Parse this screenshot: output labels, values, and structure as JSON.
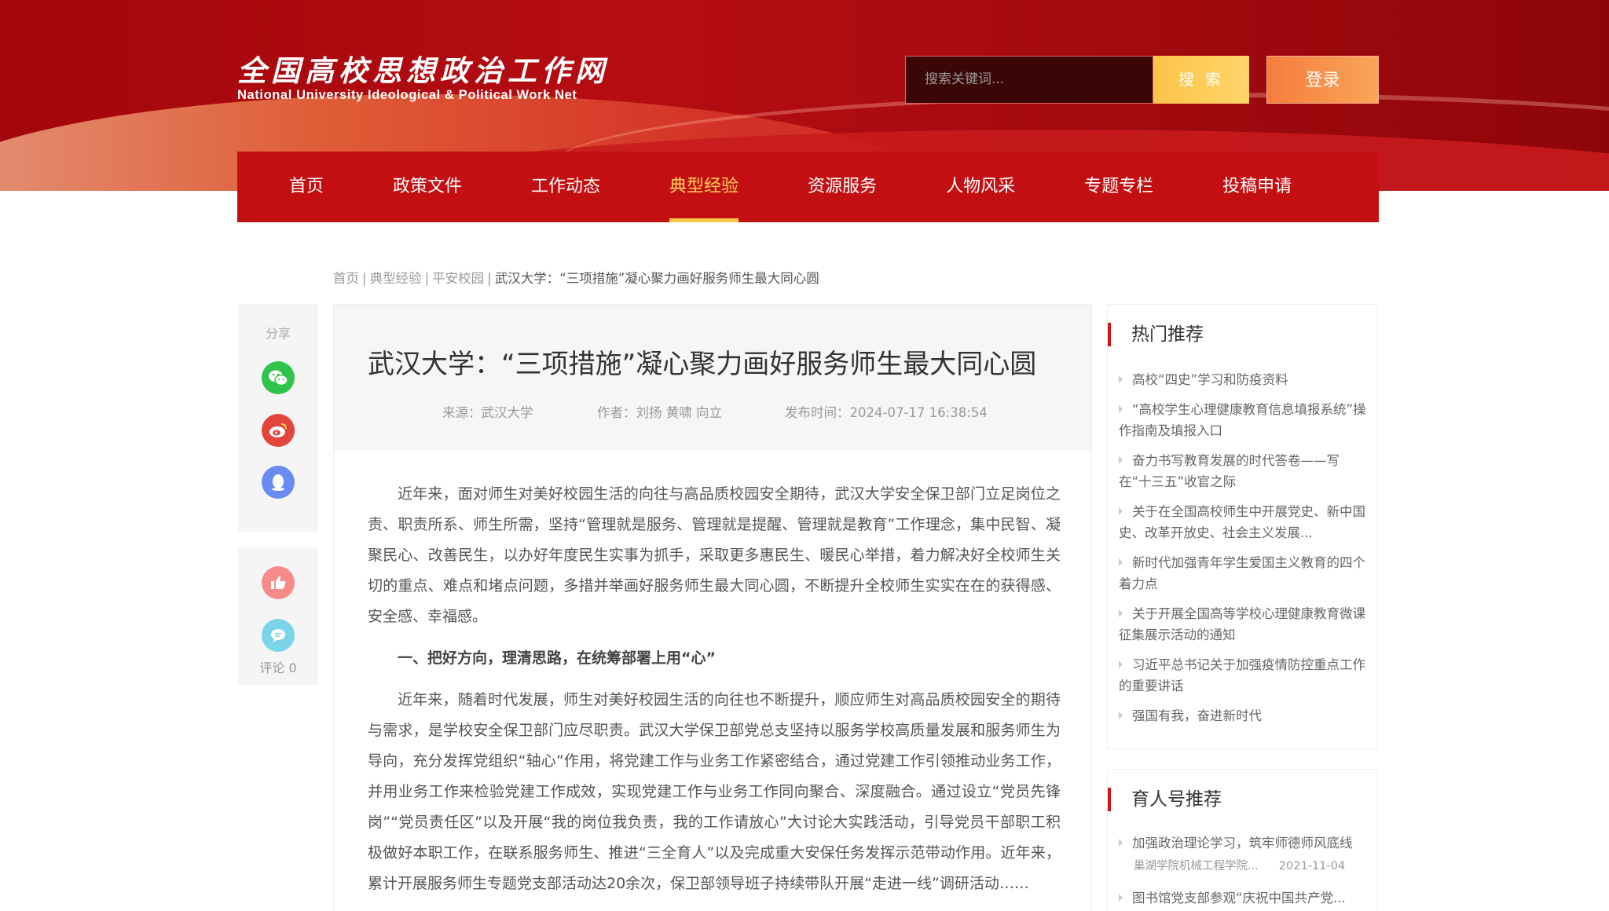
{
  "site": {
    "logo_cn": "全国高校思想政治工作网",
    "logo_en": "National University Ideological & Political Work Net"
  },
  "header": {
    "search_placeholder": "搜索关键词...",
    "search_button": "搜 索",
    "login_button": "登录"
  },
  "nav": {
    "items": [
      {
        "label": "首页"
      },
      {
        "label": "政策文件"
      },
      {
        "label": "工作动态"
      },
      {
        "label": "典型经验"
      },
      {
        "label": "资源服务"
      },
      {
        "label": "人物风采"
      },
      {
        "label": "专题专栏"
      },
      {
        "label": "投稿申请"
      }
    ],
    "active": "典型经验"
  },
  "breadcrumb": {
    "items": [
      "首页",
      "典型经验",
      "平安校园"
    ],
    "current": "武汉大学：“三项措施”凝心聚力画好服务师生最大同心圆",
    "separator": "|"
  },
  "share": {
    "label": "分享",
    "icons": [
      "wechat-icon",
      "weibo-icon",
      "qq-icon"
    ],
    "colors": {
      "wechat": "#2ec34a",
      "weibo": "#e2453b",
      "qq": "#6a8cf2",
      "like": "#f78b8b",
      "comment": "#7cd4e8"
    },
    "comment_label": "评论 0"
  },
  "article": {
    "title": "武汉大学：“三项措施”凝心聚力画好服务师生最大同心圆",
    "source": "来源：武汉大学",
    "author": "作者：刘扬 黄啸 向立",
    "published": "发布时间：2024-07-17 16:38:54",
    "para1": "近年来，面对师生对美好校园生活的向往与高品质校园安全期待，武汉大学安全保卫部门立足岗位之责、职责所系、师生所需，坚持“管理就是服务、管理就是提醒、管理就是教育”工作理念，集中民智、凝聚民心、改善民生，以办好年度民生实事为抓手，采取更多惠民生、暖民心举措，着力解决好全校师生关切的重点、难点和堵点问题，多措并举画好服务师生最大同心圆，不断提升全校师生实实在在的获得感、安全感、幸福感。",
    "heading1": "一、把好方向，理清思路，在统筹部署上用“心”",
    "para2": "近年来，随着时代发展，师生对美好校园生活的向往也不断提升，顺应师生对高品质校园安全的期待与需求，是学校安全保卫部门应尽职责。武汉大学保卫部党总支坚持以服务学校高质量发展和服务师生为导向，充分发挥党组织“轴心”作用，将党建工作与业务工作紧密结合，通过党建工作引领推动业务工作，并用业务工作来检验党建工作成效，实现党建工作与业务工作同向聚合、深度融合。通过设立“党员先锋岗”“党员责任区”以及开展“我的岗位我负责，我的工作请放心”大讨论大实践活动，引导党员干部职工积极做好本职工作，在联系服务师生、推进“三全育人”以及完成重大安保任务发挥示范带动作用。近年来，累计开展服务师生专题党支部活动达20余次，保卫部领导班子持续带队开展“走进一线”调研活动……"
  },
  "sidebar": {
    "hot_title": "热门推荐",
    "hot_items": [
      "高校“四史”学习和防疫资料",
      "“高校学生心理健康教育信息填报系统”操作指南及填报入口",
      "奋力书写教育发展的时代答卷——写在“十三五”收官之际",
      "关于在全国高校师生中开展党史、新中国史、改革开放史、社会主义发展...",
      "新时代加强青年学生爱国主义教育的四个着力点",
      "关于开展全国高等学校心理健康教育微课征集展示活动的通知",
      "习近平总书记关于加强疫情防控重点工作的重要讲话",
      "强国有我，奋进新时代"
    ],
    "yr_title": "育人号推荐",
    "yr_items": [
      {
        "title": "加强政治理论学习，筑牢师德师风底线",
        "org": "巢湖学院机械工程学院...",
        "date": "2021-11-04"
      },
      {
        "title": "图书馆党支部参观“庆祝中国共产党..."
      }
    ]
  },
  "colors": {
    "brand_red": "#c30f12",
    "active_nav": "#ffd35a",
    "search_btn": "#fbc44a",
    "login_btn": "#f57d3d",
    "accent_bar": "#d0171b"
  }
}
